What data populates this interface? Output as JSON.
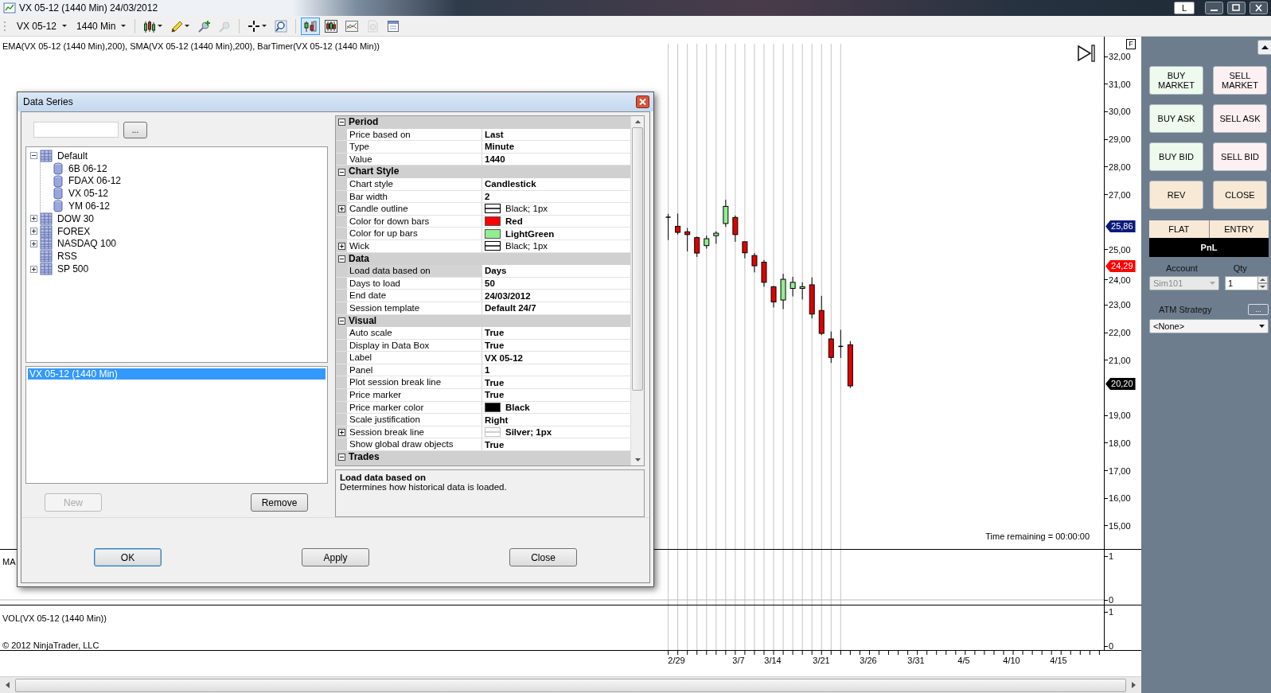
{
  "window": {
    "title": "VX 05-12 (1440 Min)  24/03/2012",
    "layout_button": "L"
  },
  "toolbar": {
    "instrument": "VX 05-12",
    "interval": "1440 Min",
    "tools": [
      {
        "kind": "candles",
        "menu": true,
        "selected": false,
        "disabled": false
      },
      {
        "kind": "pencil",
        "menu": true,
        "selected": false,
        "disabled": false
      },
      {
        "kind": "pin-add",
        "menu": false,
        "selected": false,
        "disabled": false
      },
      {
        "kind": "pin-remove",
        "menu": false,
        "selected": false,
        "disabled": true
      },
      {
        "kind": "crosshair",
        "menu": true,
        "selected": false,
        "disabled": false
      },
      {
        "kind": "zoom",
        "menu": false,
        "selected": false,
        "disabled": false
      },
      {
        "kind": "trader",
        "menu": false,
        "selected": true,
        "disabled": false
      },
      {
        "kind": "bars",
        "menu": false,
        "selected": false,
        "disabled": false
      },
      {
        "kind": "line",
        "menu": false,
        "selected": false,
        "disabled": false
      },
      {
        "kind": "coin",
        "menu": false,
        "selected": false,
        "disabled": true
      },
      {
        "kind": "window",
        "menu": false,
        "selected": false,
        "disabled": false
      }
    ]
  },
  "chart": {
    "indicators_label": "EMA(VX 05-12 (1440 Min),200), SMA(VX 05-12 (1440 Min),200), BarTimer(VX 05-12 (1440 Min))",
    "flag": "F",
    "price_axis": [
      "32,00",
      "31,00",
      "30,00",
      "29,00",
      "28,00",
      "27,00",
      "25,00",
      "24,00",
      "23,00",
      "22,00",
      "21,00",
      "19,00",
      "18,00",
      "17,00",
      "16,00",
      "15,00"
    ],
    "price_markers": [
      {
        "text": "25,86",
        "color": "#0a1a7a"
      },
      {
        "text": "24,29",
        "color": "#ff0000"
      },
      {
        "text": "20,20",
        "color": "#000000"
      }
    ],
    "time_remaining": "Time remaining = 00:00:00",
    "macd_label": "MA",
    "macd_axis": [
      "1",
      "0"
    ],
    "volume_label": "VOL(VX 05-12 (1440 Min))",
    "volume_axis": [
      "1",
      "0"
    ],
    "copyright": "© 2012 NinjaTrader, LLC",
    "date_axis": [
      "2/29",
      "3/7",
      "3/14",
      "3/21",
      "3/26",
      "3/31",
      "4/5",
      "4/10",
      "4/15"
    ]
  },
  "dialog": {
    "title": "Data Series",
    "browse_button": "...",
    "tree": [
      {
        "label": "Default",
        "kind": "group",
        "expanded": true,
        "children": [
          {
            "label": "6B 06-12",
            "kind": "instrument"
          },
          {
            "label": "FDAX 06-12",
            "kind": "instrument"
          },
          {
            "label": "VX 05-12",
            "kind": "instrument"
          },
          {
            "label": "YM 06-12",
            "kind": "instrument"
          }
        ]
      },
      {
        "label": "DOW 30",
        "kind": "group",
        "expanded": false
      },
      {
        "label": "FOREX",
        "kind": "group",
        "expanded": false
      },
      {
        "label": "NASDAQ 100",
        "kind": "group",
        "expanded": false
      },
      {
        "label": "RSS",
        "kind": "group"
      },
      {
        "label": "SP 500",
        "kind": "group",
        "expanded": false
      }
    ],
    "series": [
      {
        "label": "VX 05-12 (1440 Min)",
        "selected": true
      }
    ],
    "new_button": {
      "label": "New",
      "disabled": true
    },
    "remove_button": {
      "label": "Remove",
      "disabled": false
    },
    "properties": [
      {
        "name": "Period",
        "expanded": true,
        "items": [
          {
            "label": "Price based on",
            "value": "Last",
            "emphasized": true,
            "selected": false
          },
          {
            "label": "Type",
            "value": "Minute",
            "emphasized": true,
            "selected": false
          },
          {
            "label": "Value",
            "value": "1440",
            "emphasized": true,
            "selected": false
          }
        ]
      },
      {
        "name": "Chart Style",
        "expanded": true,
        "items": [
          {
            "label": "Chart style",
            "value": "Candlestick",
            "emphasized": true,
            "selected": false
          },
          {
            "label": "Bar width",
            "value": "2",
            "emphasized": true,
            "selected": false
          },
          {
            "label": "Candle outline",
            "value": "Black; 1px",
            "emphasized": false,
            "selected": false,
            "expanded": false,
            "swatch": {
              "kind": "pen",
              "color": "#000000"
            }
          },
          {
            "label": "Color for down bars",
            "value": "Red",
            "emphasized": true,
            "selected": false,
            "swatch": {
              "kind": "fill",
              "color": "#ff0000"
            }
          },
          {
            "label": "Color for up bars",
            "value": "LightGreen",
            "emphasized": true,
            "selected": false,
            "swatch": {
              "kind": "fill",
              "color": "#90ee90"
            }
          },
          {
            "label": "Wick",
            "value": "Black; 1px",
            "emphasized": false,
            "selected": false,
            "expanded": false,
            "swatch": {
              "kind": "pen",
              "color": "#000000"
            }
          }
        ]
      },
      {
        "name": "Data",
        "expanded": true,
        "items": [
          {
            "label": "Load data based on",
            "value": "Days",
            "emphasized": true,
            "selected": true
          },
          {
            "label": "Days to load",
            "value": "50",
            "emphasized": true,
            "selected": false
          },
          {
            "label": "End date",
            "value": "24/03/2012",
            "emphasized": true,
            "selected": false
          },
          {
            "label": "Session template",
            "value": "Default 24/7",
            "emphasized": true,
            "selected": false
          }
        ]
      },
      {
        "name": "Visual",
        "expanded": true,
        "items": [
          {
            "label": "Auto scale",
            "value": "True",
            "emphasized": true,
            "selected": false
          },
          {
            "label": "Display in Data Box",
            "value": "True",
            "emphasized": true,
            "selected": false
          },
          {
            "label": "Label",
            "value": "VX 05-12",
            "emphasized": true,
            "selected": false
          },
          {
            "label": "Panel",
            "value": "1",
            "emphasized": true,
            "selected": false
          },
          {
            "label": "Plot session break line",
            "value": "True",
            "emphasized": true,
            "selected": false
          },
          {
            "label": "Price marker",
            "value": "True",
            "emphasized": true,
            "selected": false
          },
          {
            "label": "Price marker color",
            "value": "Black",
            "emphasized": true,
            "selected": false,
            "swatch": {
              "kind": "fill",
              "color": "#000000"
            }
          },
          {
            "label": "Scale justification",
            "value": "Right",
            "emphasized": true,
            "selected": false
          },
          {
            "label": "Session break line",
            "value": "Silver; 1px",
            "emphasized": true,
            "selected": false,
            "expanded": false,
            "swatch": {
              "kind": "pen",
              "color": "#c0c0c0"
            }
          },
          {
            "label": "Show global draw objects",
            "value": "True",
            "emphasized": true,
            "selected": false
          }
        ]
      },
      {
        "name": "Trades",
        "expanded": true
      }
    ],
    "description": {
      "title": "Load data based on",
      "text": "Determines how historical data is loaded."
    },
    "buttons": [
      {
        "label": "OK",
        "default": true
      },
      {
        "label": "Apply",
        "default": false
      },
      {
        "label": "Close",
        "default": false
      }
    ]
  },
  "chart_trader": {
    "order_buttons": [
      {
        "label": "BUY MARKET",
        "kind": "buy"
      },
      {
        "label": "SELL MARKET",
        "kind": "sell"
      },
      {
        "label": "BUY ASK",
        "kind": "buy"
      },
      {
        "label": "SELL ASK",
        "kind": "sell"
      },
      {
        "label": "BUY BID",
        "kind": "buy"
      },
      {
        "label": "SELL BID",
        "kind": "sell"
      },
      {
        "label": "REV",
        "kind": "neutral"
      },
      {
        "label": "CLOSE",
        "kind": "neutral"
      }
    ],
    "position": "FLAT",
    "entry": "ENTRY",
    "pnl": "PnL",
    "account_label": "Account",
    "account": {
      "value": "Sim101",
      "disabled": true
    },
    "qty_label": "Qty",
    "qty": "1",
    "atm_label": "ATM Strategy",
    "atm_button": "...",
    "atm_strategy": "<None>"
  }
}
